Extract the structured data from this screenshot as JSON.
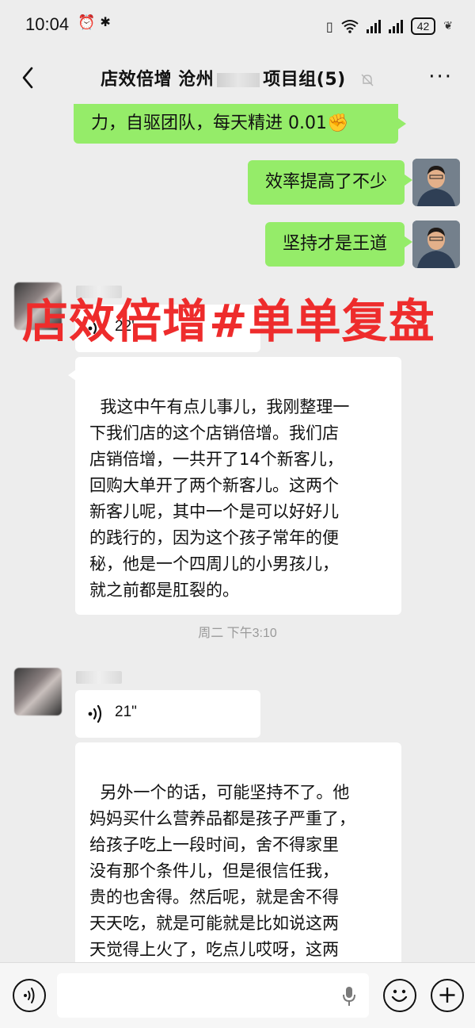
{
  "status_bar": {
    "time": "10:04",
    "battery": "42"
  },
  "header": {
    "title_prefix": "店效倍增 沧州",
    "title_suffix": "项目组(5)",
    "more_label": "···"
  },
  "messages": {
    "sent_partial": "力，自驱团队，每天精进 0.01✊",
    "sent_1": "效率提高了不少",
    "sent_2": "坚持才是王道",
    "voice_1_length": "22'",
    "text_1": "我这中午有点儿事儿，我刚整理一\n下我们店的这个店销倍增。我们店\n店销倍增，一共开了14个新客儿，\n回购大单开了两个新客儿。这两个\n新客儿呢，其中一个是可以好好儿\n的践行的，因为这个孩子常年的便\n秘，他是一个四周儿的小男孩儿，\n就之前都是肛裂的。",
    "timestamp": "周二 下午3:10",
    "voice_2_length": "21\"",
    "text_2": "另外一个的话，可能坚持不了。他\n妈妈买什么营养品都是孩子严重了，\n给孩子吃上一段时间，舍不得家里\n没有那个条件儿，但是很信任我，\n贵的也舍得。然后呢，就是舍不得\n天天吃，就是可能就是比如说这两\n天觉得上火了，吃点儿哎呀，这两\n天不舒服了，吃点儿不能坚持。"
  },
  "overlay_caption": "店效倍增#单单复盘",
  "colors": {
    "sent_bubble": "#95ec69",
    "overlay_text": "#ee2c2c",
    "background": "#ededed"
  },
  "icons": [
    "back-arrow-icon",
    "mute-bell-icon",
    "more-icon",
    "voice-wave-icon",
    "microphone-icon",
    "emoji-icon",
    "plus-icon"
  ]
}
